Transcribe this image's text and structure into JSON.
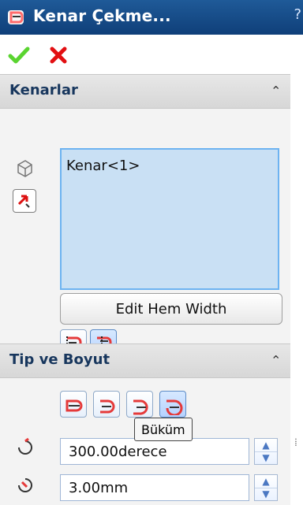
{
  "title": "Kenar Çekme...",
  "help_mark": "?",
  "sections": {
    "edges": {
      "title": "Kenarlar",
      "items": [
        "Kenar<1>"
      ],
      "edit_button": "Edit Hem Width"
    },
    "type_size": {
      "title": "Tip ve Boyut",
      "tooltip": "Büküm",
      "angle_value": "300.00derece",
      "radius_value": "3.00mm"
    }
  },
  "sidebar": {
    "handle": "⁞"
  },
  "colors": {
    "title_bar": "#1f5a98",
    "list_bg": "#c9e0f4",
    "list_border": "#6db3f1",
    "ok_green": "#5ad430",
    "cancel_red": "#e20f12",
    "accent_red": "#e53a3a"
  }
}
